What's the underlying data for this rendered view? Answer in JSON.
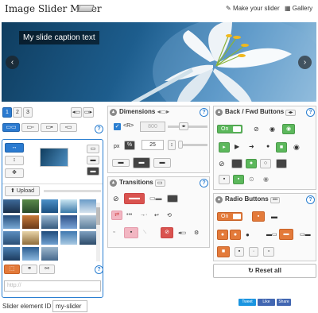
{
  "header": {
    "logo_text": "Image Slider Maker",
    "make_slider_label": "Make your slider",
    "gallery_label": "Gallery"
  },
  "slider": {
    "caption": "My slide caption text",
    "prev_arrow": "‹",
    "next_arrow": "›",
    "slide_count": 3,
    "active_slide": 1
  },
  "slides_tabs": [
    "1",
    "2",
    "3"
  ],
  "left_panel": {
    "upload_label": "Upload",
    "url_placeholder": "http://",
    "slider_id_label": "Slider element ID",
    "slider_id_value": "my-slider"
  },
  "dimensions": {
    "title": "Dimensions",
    "width_value": "800",
    "unit_px": "px",
    "unit_pct": "%",
    "height_value": "25",
    "ratio_label": "<R>"
  },
  "transitions": {
    "title": "Transitions"
  },
  "back_fwd": {
    "title": "Back / Fwd Buttons",
    "toggle_label": "On"
  },
  "radio_buttons": {
    "title": "Radio Buttons",
    "reset_label": "Reset all"
  },
  "social": {
    "tweet": "Tweet",
    "like": "Like",
    "share": "Share"
  },
  "colors": {
    "accent_blue": "#2b7fd1",
    "toggle_green": "#5cb85c",
    "orange": "#e37a3a",
    "red": "#d9534f"
  }
}
